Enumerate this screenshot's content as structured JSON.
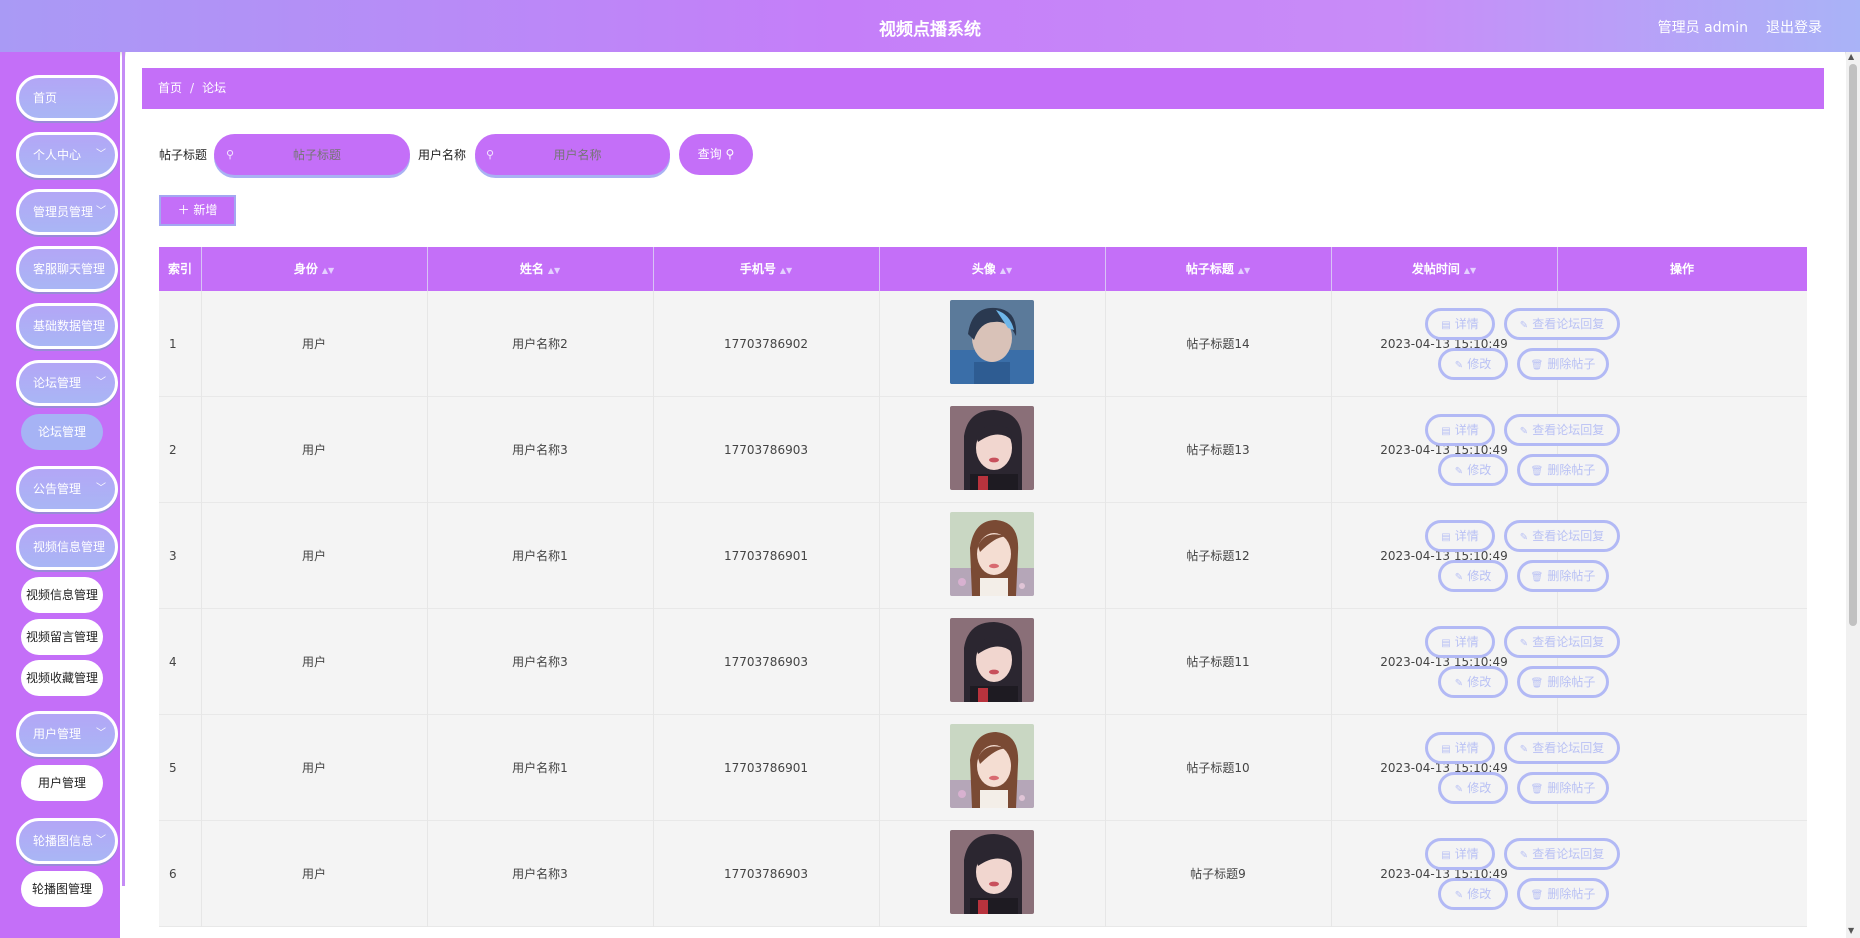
{
  "header": {
    "title": "视频点播系统",
    "user": "管理员 admin",
    "logout": "退出登录"
  },
  "sidebar": {
    "items": [
      {
        "label": "首页",
        "chevron": false
      },
      {
        "label": "个人中心",
        "chevron": true
      },
      {
        "label": "管理员管理",
        "chevron": true
      },
      {
        "label": "客服聊天管理",
        "chevron": true
      },
      {
        "label": "基础数据管理",
        "chevron": true
      },
      {
        "label": "论坛管理",
        "chevron": true
      },
      {
        "label": "公告管理",
        "chevron": true
      },
      {
        "label": "视频信息管理",
        "chevron": true
      },
      {
        "label": "用户管理",
        "chevron": true
      },
      {
        "label": "轮播图信息",
        "chevron": true
      }
    ],
    "sub_forum": "论坛管理",
    "sub_video": [
      "视频信息管理",
      "视频留言管理",
      "视频收藏管理"
    ],
    "sub_user": "用户管理",
    "sub_carousel": "轮播图管理"
  },
  "breadcrumb": {
    "home": "首页",
    "current": "论坛"
  },
  "search": {
    "title_label": "帖子标题",
    "title_placeholder": "帖子标题",
    "user_label": "用户名称",
    "user_placeholder": "用户名称",
    "query_label": "查询"
  },
  "add_label": "新增",
  "table": {
    "headers": [
      "索引",
      "身份",
      "姓名",
      "手机号",
      "头像",
      "帖子标题",
      "发帖时间",
      "操作"
    ],
    "rows": [
      {
        "index": "1",
        "role": "用户",
        "name": "用户名称2",
        "phone": "17703786902",
        "avatar": "boy",
        "title": "帖子标题14",
        "time": "2023-04-13 15:10:49"
      },
      {
        "index": "2",
        "role": "用户",
        "name": "用户名称3",
        "phone": "17703786903",
        "avatar": "girl-dark",
        "title": "帖子标题13",
        "time": "2023-04-13 15:10:49"
      },
      {
        "index": "3",
        "role": "用户",
        "name": "用户名称1",
        "phone": "17703786901",
        "avatar": "girl-light",
        "title": "帖子标题12",
        "time": "2023-04-13 15:10:49"
      },
      {
        "index": "4",
        "role": "用户",
        "name": "用户名称3",
        "phone": "17703786903",
        "avatar": "girl-dark",
        "title": "帖子标题11",
        "time": "2023-04-13 15:10:49"
      },
      {
        "index": "5",
        "role": "用户",
        "name": "用户名称1",
        "phone": "17703786901",
        "avatar": "girl-light",
        "title": "帖子标题10",
        "time": "2023-04-13 15:10:49"
      },
      {
        "index": "6",
        "role": "用户",
        "name": "用户名称3",
        "phone": "17703786903",
        "avatar": "girl-dark",
        "title": "帖子标题9",
        "time": "2023-04-13 15:10:49"
      }
    ],
    "actions": {
      "detail": "详情",
      "view_reply": "查看论坛回复",
      "edit": "修改",
      "delete": "删除帖子"
    }
  },
  "colors": {
    "primary": "#c46ff8",
    "accent_blue": "#a9b6f5"
  }
}
